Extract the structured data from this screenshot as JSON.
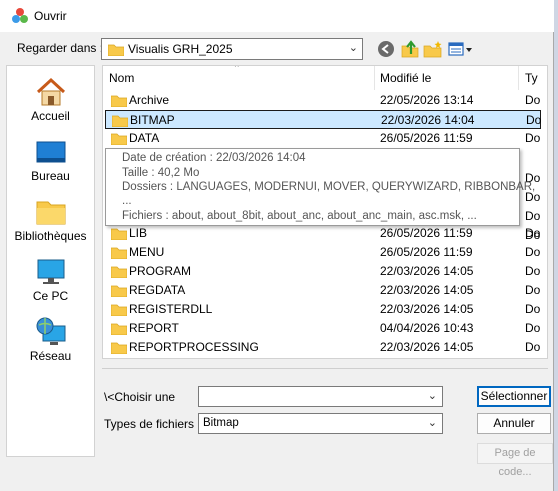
{
  "window": {
    "title": "Ouvrir"
  },
  "lookin": {
    "label": "Regarder dans :",
    "value": "Visualis GRH_2025"
  },
  "places": [
    {
      "label": "Accueil",
      "icon": "home-icon"
    },
    {
      "label": "Bureau",
      "icon": "desktop-icon"
    },
    {
      "label": "Bibliothèques",
      "icon": "libraries-icon"
    },
    {
      "label": "Ce PC",
      "icon": "computer-icon"
    },
    {
      "label": "Réseau",
      "icon": "network-icon"
    }
  ],
  "columns": {
    "name": "Nom",
    "modified": "Modifié le",
    "type": "Ty"
  },
  "files": [
    {
      "name": "Archive",
      "date": "22/05/2026 13:14",
      "type": "Do"
    },
    {
      "name": "BITMAP",
      "date": "22/03/2026 14:04",
      "type": "Do"
    },
    {
      "name": "DATA",
      "date": "26/05/2026 11:59",
      "type": "Do"
    },
    {
      "name": "LIB",
      "date": "26/05/2026 11:59",
      "type": "Do"
    },
    {
      "name": "MENU",
      "date": "26/05/2026 11:59",
      "type": "Do"
    },
    {
      "name": "PROGRAM",
      "date": "22/03/2026 14:05",
      "type": "Do"
    },
    {
      "name": "REGDATA",
      "date": "22/03/2026 14:05",
      "type": "Do"
    },
    {
      "name": "REGISTERDLL",
      "date": "22/03/2026 14:05",
      "type": "Do"
    },
    {
      "name": "REPORT",
      "date": "04/04/2026 10:43",
      "type": "Do"
    },
    {
      "name": "REPORTPROCESSING",
      "date": "22/03/2026 14:05",
      "type": "Do"
    }
  ],
  "hidden_row_types": [
    "Do",
    "Do",
    "Do",
    "Do"
  ],
  "tooltip": {
    "created": "Date de création : 22/03/2026 14:04",
    "size": "Taille : 40,2 Mo",
    "folders": "Dossiers : LANGUAGES, MODERNUI, MOVER, QUERYWIZARD, RIBBONBAR,",
    "ellipsis": "...",
    "files": "Fichiers : about, about_8bit, about_anc, about_anc_main, asc.msk, ..."
  },
  "filename": {
    "label": "\\<Choisir une",
    "value": ""
  },
  "filetype": {
    "label": "Types de fichiers :",
    "value": "Bitmap"
  },
  "buttons": {
    "select": "Sélectionner",
    "cancel": "Annuler",
    "pagecode": "Page de code..."
  },
  "colors": {
    "selection": "#cce8ff",
    "primary_border": "#0067c0",
    "folder": "#f8c94a"
  }
}
